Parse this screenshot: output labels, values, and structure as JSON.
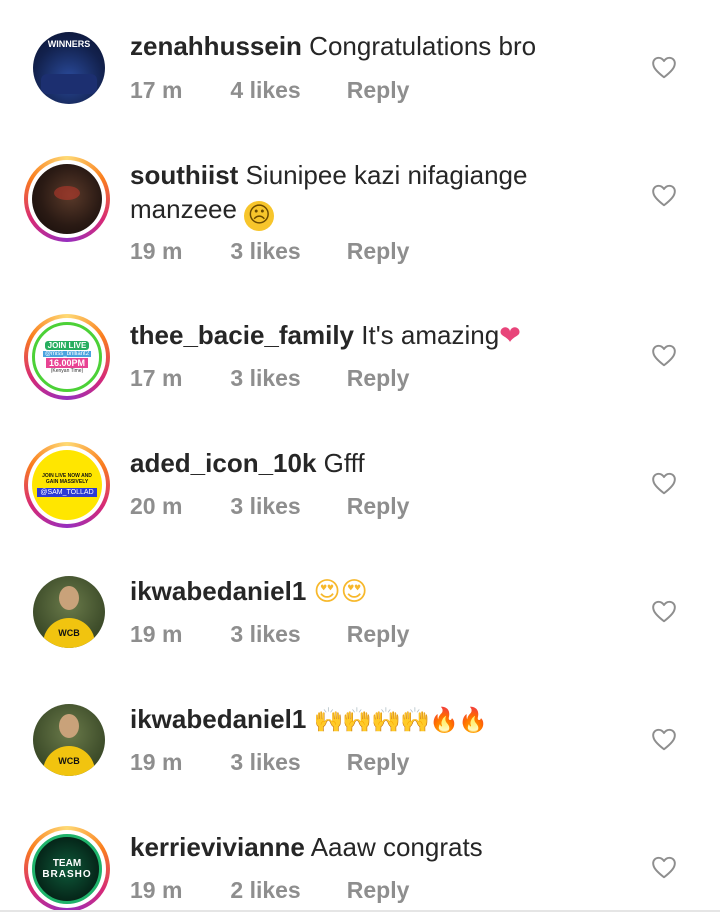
{
  "comments": [
    {
      "username": "zenahhussein",
      "text": "Congratulations bro",
      "emoji": "",
      "time": "17 m",
      "likes": "4 likes",
      "reply": "Reply",
      "avatar_text": "WINNERS"
    },
    {
      "username": "southiist",
      "text": "Siunipee kazi nifagiange manzeee",
      "emoji": "☹",
      "time": "19 m",
      "likes": "3 likes",
      "reply": "Reply",
      "avatar_text": ""
    },
    {
      "username": "thee_bacie_family",
      "text": "It's amazing",
      "emoji": "❤",
      "time": "17 m",
      "likes": "3 likes",
      "reply": "Reply",
      "avatar_text": "JOIN LIVE",
      "avatar_text2": "@miss_brilliant2",
      "avatar_text3": "16.00PM",
      "avatar_text4": "(Kenyan Time)"
    },
    {
      "username": "aded_icon_10k",
      "text": "Gfff",
      "emoji": "",
      "time": "20 m",
      "likes": "3 likes",
      "reply": "Reply",
      "avatar_text": "JOIN LIVE NOW AND GAIN MASSIVELY",
      "avatar_text2": "@SAM_TOLLAD"
    },
    {
      "username": "ikwabedaniel1",
      "text": "",
      "emoji": "😍😍",
      "time": "19 m",
      "likes": "3 likes",
      "reply": "Reply",
      "avatar_text": "WCB"
    },
    {
      "username": "ikwabedaniel1",
      "text": "",
      "emoji": "🙌🙌🙌🙌🔥🔥",
      "time": "19 m",
      "likes": "3 likes",
      "reply": "Reply",
      "avatar_text": "WCB"
    },
    {
      "username": "kerrievivianne",
      "text": "Aaaw congrats",
      "emoji": "",
      "time": "19 m",
      "likes": "2 likes",
      "reply": "Reply",
      "avatar_text": "TEAM",
      "avatar_text2": "BRASHO"
    }
  ],
  "colors": {
    "meta": "#8e8e8e",
    "text": "#262626",
    "heart_emoji": "#e8457a",
    "story_ring": "#d62976"
  },
  "icons": {
    "like": "heart-outline-icon"
  }
}
